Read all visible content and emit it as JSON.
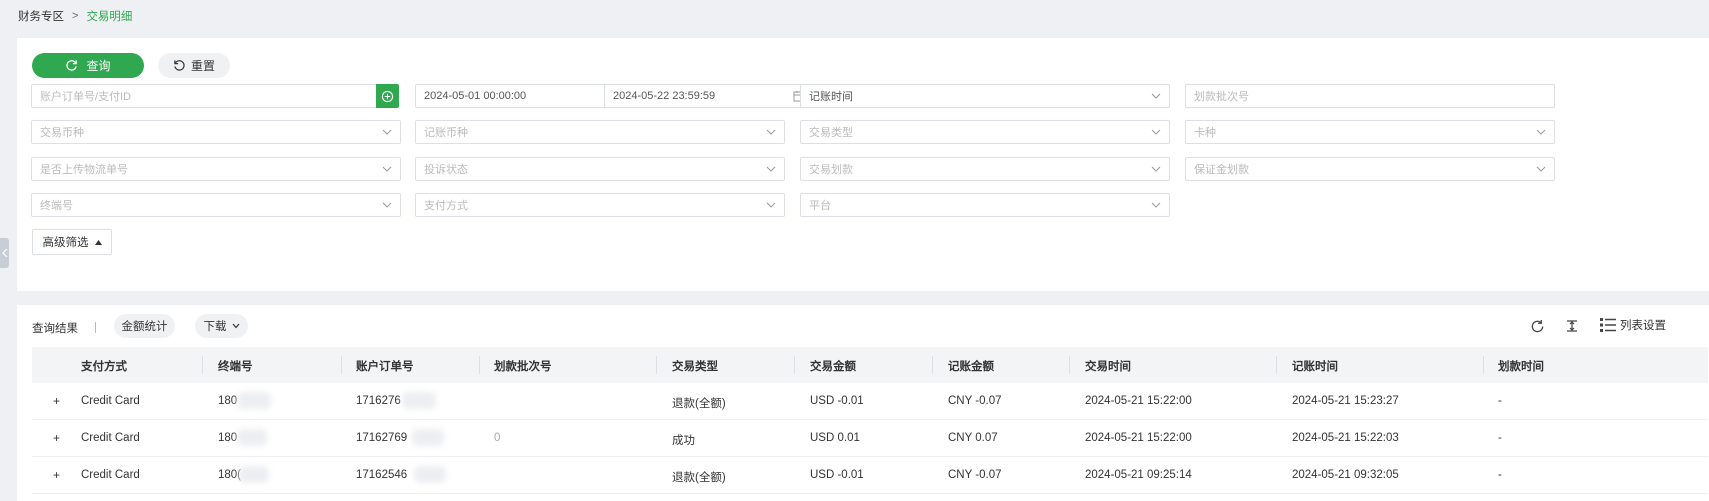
{
  "breadcrumb": {
    "root": "财务专区",
    "separator": ">",
    "current": "交易明细"
  },
  "actions": {
    "query_label": "查询",
    "reset_label": "重置"
  },
  "filters": {
    "order_id": {
      "placeholder": "账户订单号/支付ID"
    },
    "date_start": "2024-05-01 00:00:00",
    "date_sep": "-",
    "date_end": "2024-05-22 23:59:59",
    "time_type": "记账时间",
    "batch_no": {
      "placeholder": "划款批次号"
    },
    "trade_currency": {
      "placeholder": "交易币种"
    },
    "book_currency": {
      "placeholder": "记账币种"
    },
    "trade_type": {
      "placeholder": "交易类型"
    },
    "card_type": {
      "placeholder": "卡种"
    },
    "logistics_uploaded": {
      "placeholder": "是否上传物流单号"
    },
    "complaint_status": {
      "placeholder": "投诉状态"
    },
    "trade_transfer": {
      "placeholder": "交易划款"
    },
    "deposit_transfer": {
      "placeholder": "保证金划款"
    },
    "terminal_no": {
      "placeholder": "终端号"
    },
    "payment_method": {
      "placeholder": "支付方式"
    },
    "platform": {
      "placeholder": "平台"
    },
    "advanced_label": "高级筛选"
  },
  "results": {
    "title": "查询结果",
    "amount_stats_label": "金额统计",
    "download_label": "下载",
    "list_settings_label": "列表设置",
    "columns": [
      "支付方式",
      "终端号",
      "账户订单号",
      "划款批次号",
      "交易类型",
      "交易金额",
      "记账金额",
      "交易时间",
      "记账时间",
      "划款时间"
    ],
    "rows": [
      {
        "expand": "+",
        "payment_method": "Credit Card",
        "terminal": "180",
        "order_no": "1716276",
        "batch_no": "",
        "trade_type": "退款(全额)",
        "trade_amount": "USD -0.01",
        "book_amount": "CNY -0.07",
        "trade_time": "2024-05-21 15:22:00",
        "book_time": "2024-05-21 15:23:27",
        "transfer_time": "-"
      },
      {
        "expand": "+",
        "payment_method": "Credit Card",
        "terminal": "180",
        "order_no": "17162769",
        "batch_no": "0",
        "trade_type": "成功",
        "trade_amount": "USD 0.01",
        "book_amount": "CNY 0.07",
        "trade_time": "2024-05-21 15:22:00",
        "book_time": "2024-05-21 15:22:03",
        "transfer_time": "-"
      },
      {
        "expand": "+",
        "payment_method": "Credit Card",
        "terminal": "180(",
        "order_no": "17162546",
        "batch_no": "",
        "trade_type": "退款(全额)",
        "trade_amount": "USD -0.01",
        "book_amount": "CNY -0.07",
        "trade_time": "2024-05-21 09:25:14",
        "book_time": "2024-05-21 09:32:05",
        "transfer_time": "-"
      }
    ]
  },
  "colors": {
    "accent": "#2fa84f",
    "page_bg": "#eef0f3",
    "header_bg": "#f3f4f6"
  }
}
